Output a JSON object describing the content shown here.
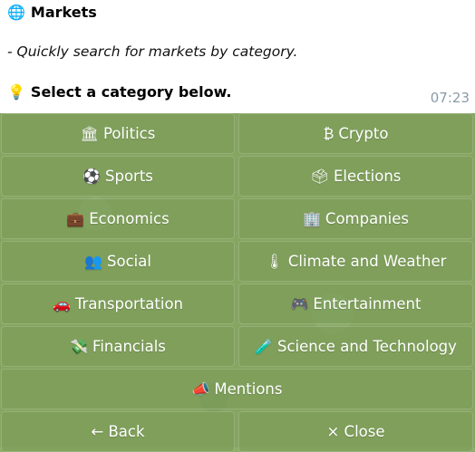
{
  "message": {
    "title": "Markets",
    "title_icon": "globe-icon",
    "subtitle": "- Quickly search for markets by category.",
    "prompt": "Select a category below.",
    "prompt_icon": "lightbulb-icon",
    "time": "07:23"
  },
  "keyboard": {
    "politics": {
      "icon": "🏛",
      "label": "Politics"
    },
    "crypto": {
      "icon": "₿",
      "label": "Crypto"
    },
    "sports": {
      "icon": "⚽",
      "label": "Sports"
    },
    "elections": {
      "icon": "🗳",
      "label": "Elections"
    },
    "economics": {
      "icon": "💼",
      "label": "Economics"
    },
    "companies": {
      "icon": "🏢",
      "label": "Companies"
    },
    "social": {
      "icon": "👥",
      "label": "Social"
    },
    "climate": {
      "icon": "🌡",
      "label": "Climate and Weather"
    },
    "transportation": {
      "icon": "🚗",
      "label": "Transportation"
    },
    "entertainment": {
      "icon": "🎮",
      "label": "Entertainment"
    },
    "financials": {
      "icon": "💸",
      "label": "Financials"
    },
    "science": {
      "icon": "🧪",
      "label": "Science and Technology"
    },
    "mentions": {
      "icon": "📣",
      "label": "Mentions"
    },
    "back": {
      "label": "← Back"
    },
    "close": {
      "label": "× Close"
    }
  },
  "colors": {
    "keyboard_bg": "#87a562",
    "button_text": "#ffffff",
    "timestamp": "#8a9ba8"
  }
}
